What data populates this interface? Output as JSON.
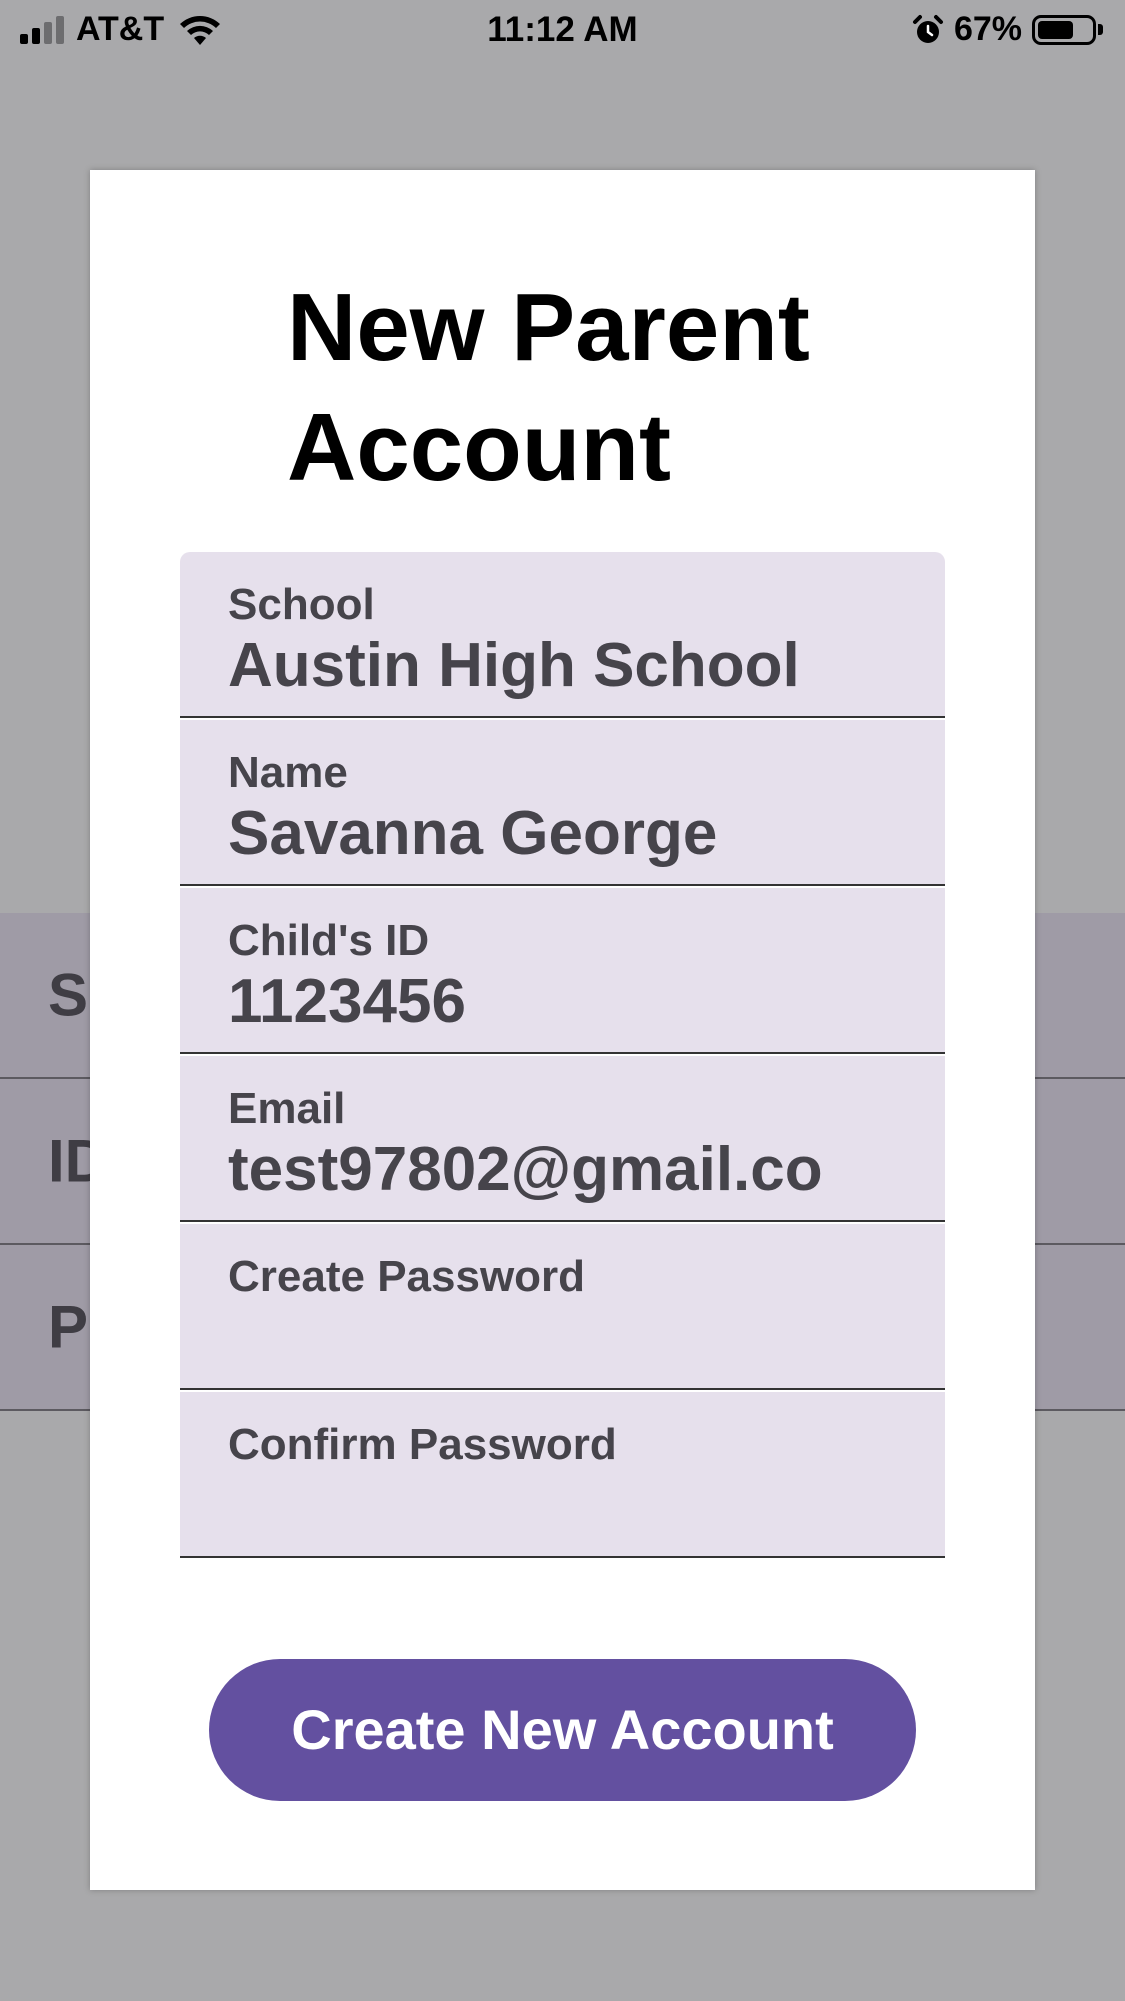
{
  "status_bar": {
    "carrier": "AT&T",
    "time": "11:12 AM",
    "battery_percent": "67%",
    "battery_level": 0.67,
    "signal_bars": 2,
    "icons": [
      "signal-icon",
      "wifi-icon",
      "alarm-icon",
      "battery-icon"
    ]
  },
  "background_rows": [
    {
      "letter": "S"
    },
    {
      "letter": "ID"
    },
    {
      "letter": "P"
    }
  ],
  "modal": {
    "title": "New Parent Account",
    "fields": [
      {
        "label": "School",
        "value": "Austin High School"
      },
      {
        "label": "Name",
        "value": "Savanna George"
      },
      {
        "label": "Child's ID",
        "value": "1123456"
      },
      {
        "label": "Email",
        "value": "test97802@gmail.co"
      },
      {
        "label": "Create Password",
        "value": ""
      },
      {
        "label": "Confirm Password",
        "value": ""
      }
    ],
    "submit_label": "Create New Account"
  },
  "colors": {
    "accent": "#6350a0",
    "field_background": "#e6e0ec",
    "overlay_background": "#a9a9ab"
  }
}
